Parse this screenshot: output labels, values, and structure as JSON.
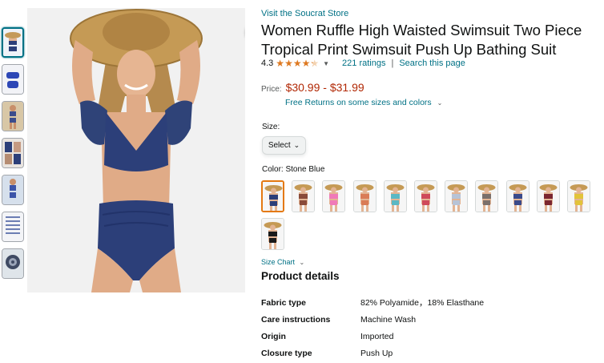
{
  "store_link": "Visit the Soucrat Store",
  "title": "Women Ruffle High Waisted Swimsuit Two Piece Tropical Print Swimsuit Push Up Bathing Suit",
  "rating": {
    "value": "4.3",
    "stars": 4.3,
    "count_text": "221 ratings",
    "search_text": "Search this page",
    "separator": "|"
  },
  "price": {
    "label": "Price:",
    "value": "$30.99 - $31.99",
    "free_returns": "Free Returns on some sizes and colors"
  },
  "size": {
    "label": "Size:",
    "select_label": "Select"
  },
  "color": {
    "label": "Color: Stone Blue"
  },
  "size_chart": "Size Chart",
  "details": {
    "title": "Product details",
    "rows": [
      {
        "key": "Fabric type",
        "value": "82% Polyamide，18% Elasthane"
      },
      {
        "key": "Care instructions",
        "value": "Machine Wash"
      },
      {
        "key": "Origin",
        "value": "Imported"
      },
      {
        "key": "Closure type",
        "value": "Push Up"
      }
    ]
  },
  "swatch_colors": [
    "#2c3f79",
    "#8a4b3a",
    "#f07ab8",
    "#d97c57",
    "#5cb8c4",
    "#cf4a5a",
    "#b7c3d6",
    "#7b6f6a",
    "#3a4a8a",
    "#7a2630",
    "#e2c33a",
    "#1a1a1a"
  ],
  "colors": {
    "link": "#007185",
    "price": "#b12704",
    "star": "#de7921",
    "selected_border": "#e47911"
  }
}
